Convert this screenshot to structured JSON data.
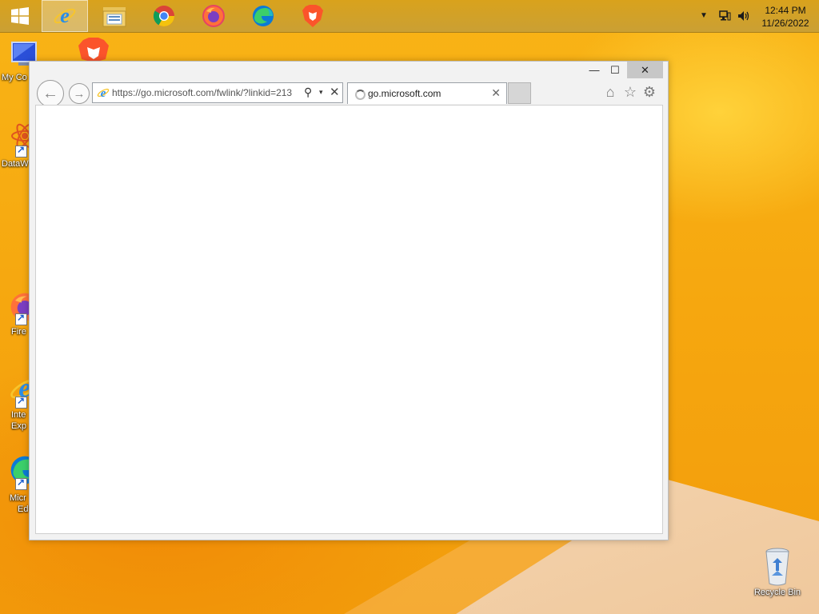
{
  "taskbar": {
    "apps": [
      {
        "name": "Internet Explorer",
        "icon": "internet-explorer-icon",
        "active": true
      },
      {
        "name": "File Explorer",
        "icon": "file-explorer-icon",
        "active": false
      },
      {
        "name": "Google Chrome",
        "icon": "chrome-icon",
        "active": false
      },
      {
        "name": "Firefox",
        "icon": "firefox-icon",
        "active": false
      },
      {
        "name": "Microsoft Edge",
        "icon": "edge-icon",
        "active": false
      },
      {
        "name": "Brave",
        "icon": "brave-icon",
        "active": false
      }
    ],
    "clock": {
      "time": "12:44 PM",
      "date": "11/26/2022"
    }
  },
  "desktop": {
    "icons": [
      {
        "label": "My Co",
        "icon": "computer-icon"
      },
      {
        "label": "DataW",
        "icon": "datawrapper-icon"
      },
      {
        "label": "Fire",
        "icon": "firefox-icon"
      },
      {
        "label_line1": "Inte",
        "label_line2": "Exp",
        "icon": "internet-explorer-icon"
      },
      {
        "label_line1": "Micr",
        "label_line2": "Ed",
        "icon": "edge-icon"
      },
      {
        "label": "Recycle Bin",
        "icon": "recycle-bin-icon"
      }
    ]
  },
  "browser": {
    "window_controls": {
      "minimize": "—",
      "maximize": "☐",
      "close": "✕"
    },
    "address": {
      "url": "https://go.microsoft.com/fwlink/?linkid=213",
      "stop": "✕",
      "search": "⚲",
      "dropdown": "▾"
    },
    "tab": {
      "title": "go.microsoft.com",
      "close": "✕"
    },
    "nav": {
      "back": "←",
      "forward": "→"
    },
    "toolbar": {
      "home": "⌂",
      "favorites": "☆",
      "tools": "⚙"
    }
  },
  "colors": {
    "wallpaper": "#f5a70e",
    "taskbar": "#d9a21c",
    "window_frame": "#f2f2f2",
    "close_button": "#c7c7c7"
  }
}
